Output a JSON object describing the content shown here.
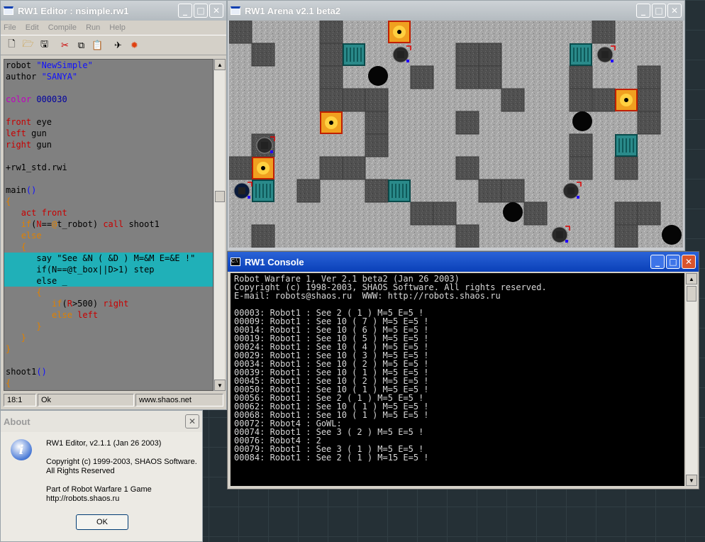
{
  "editor": {
    "title": "RW1 Editor : nsimple.rw1",
    "menu": [
      "File",
      "Edit",
      "Compile",
      "Run",
      "Help"
    ],
    "toolbar_icons": [
      "new-file-icon",
      "open-folder-icon",
      "save-icon",
      "cut-icon",
      "copy-icon",
      "paste-icon",
      "compile-icon",
      "run-icon"
    ],
    "code_lines": [
      [
        [
          "k",
          "robot "
        ],
        [
          "s",
          "\"NewSimple\""
        ]
      ],
      [
        [
          "k",
          "author "
        ],
        [
          "s",
          "\"SANYA\""
        ]
      ],
      [],
      [
        [
          "m",
          "color "
        ],
        [
          "b",
          "000030"
        ]
      ],
      [],
      [
        [
          "r",
          "front "
        ],
        [
          "k",
          "eye"
        ]
      ],
      [
        [
          "r",
          "left "
        ],
        [
          "k",
          "gun"
        ]
      ],
      [
        [
          "r",
          "right "
        ],
        [
          "k",
          "gun"
        ]
      ],
      [],
      [
        [
          "k",
          "+rw1_std.rwi"
        ]
      ],
      [],
      [
        [
          "k",
          "main"
        ],
        [
          "s",
          "()"
        ]
      ],
      [
        [
          "o",
          "{"
        ]
      ],
      [
        [
          "k",
          "   "
        ],
        [
          "r",
          "act front"
        ]
      ],
      [
        [
          "k",
          "   "
        ],
        [
          "o",
          "if"
        ],
        [
          "k",
          "("
        ],
        [
          "r",
          "N"
        ],
        [
          "k",
          "=="
        ],
        [
          "o",
          "@"
        ],
        [
          "k",
          "t_robot) "
        ],
        [
          "r",
          "call "
        ],
        [
          "k",
          "shoot1"
        ]
      ],
      [
        [
          "k",
          "   "
        ],
        [
          "o",
          "else"
        ]
      ],
      [
        [
          "k",
          "   "
        ],
        [
          "o",
          "{"
        ]
      ],
      [
        [
          "k",
          "      say \"See &N ( &D ) M=&M E=&E !\""
        ]
      ],
      [
        [
          "k",
          "      if(N==@t_box||D>1) step"
        ]
      ],
      [
        [
          "k",
          "      else _"
        ]
      ],
      [
        [
          "k",
          "      "
        ],
        [
          "o",
          "{"
        ]
      ],
      [
        [
          "k",
          "         "
        ],
        [
          "o",
          "if"
        ],
        [
          "k",
          "("
        ],
        [
          "r",
          "R"
        ],
        [
          "k",
          ">500) "
        ],
        [
          "r",
          "right"
        ]
      ],
      [
        [
          "k",
          "         "
        ],
        [
          "o",
          "else "
        ],
        [
          "r",
          "left"
        ]
      ],
      [
        [
          "k",
          "      "
        ],
        [
          "o",
          "}"
        ]
      ],
      [
        [
          "k",
          "   "
        ],
        [
          "o",
          "}"
        ]
      ],
      [
        [
          "o",
          "}"
        ]
      ],
      [],
      [
        [
          "k",
          "shoot1"
        ],
        [
          "s",
          "()"
        ]
      ],
      [
        [
          "o",
          "{"
        ]
      ]
    ],
    "highlight_lines": [
      17,
      18,
      19
    ],
    "status": {
      "position": "18:1",
      "state": "Ok",
      "url": "www.shaos.net"
    }
  },
  "arena": {
    "title": "RW1 Arena v2.1 beta2"
  },
  "console": {
    "title": "RW1 Console",
    "lines": [
      "Robot Warfare 1, Ver 2.1 beta2 (Jan 26 2003)",
      "Copyright (c) 1998-2003, SHAOS Software. All rights reserved.",
      "E-mail: robots@shaos.ru  WWW: http://robots.shaos.ru",
      "",
      "00003: Robot1 : See 2 ( 1 ) M=5 E=5 !",
      "00009: Robot1 : See 10 ( 7 ) M=5 E=5 !",
      "00014: Robot1 : See 10 ( 6 ) M=5 E=5 !",
      "00019: Robot1 : See 10 ( 5 ) M=5 E=5 !",
      "00024: Robot1 : See 10 ( 4 ) M=5 E=5 !",
      "00029: Robot1 : See 10 ( 3 ) M=5 E=5 !",
      "00034: Robot1 : See 10 ( 2 ) M=5 E=5 !",
      "00039: Robot1 : See 10 ( 1 ) M=5 E=5 !",
      "00045: Robot1 : See 10 ( 2 ) M=5 E=5 !",
      "00050: Robot1 : See 10 ( 1 ) M=5 E=5 !",
      "00056: Robot1 : See 2 ( 1 ) M=5 E=5 !",
      "00062: Robot1 : See 10 ( 1 ) M=5 E=5 !",
      "00068: Robot1 : See 10 ( 1 ) M=5 E=5 !",
      "00072: Robot4 : GoWL:",
      "00074: Robot1 : See 3 ( 2 ) M=5 E=5 !",
      "00076: Robot4 : 2",
      "00079: Robot1 : See 3 ( 1 ) M=5 E=5 !",
      "00084: Robot1 : See 2 ( 1 ) M=15 E=5 !"
    ]
  },
  "about": {
    "title": "About",
    "product": "RW1 Editor, v2.1.1 (Jan 26 2003)",
    "copyright": "Copyright (c) 1999-2003, SHAOS Software.",
    "rights": "All Rights Reserved",
    "part_of": "Part of Robot Warfare 1 Game",
    "url": "http://robots.shaos.ru",
    "ok_label": "OK"
  },
  "colors": {
    "title_active": "#0a40b8",
    "highlight": "#20b0b8",
    "code_bg": "#808080"
  }
}
